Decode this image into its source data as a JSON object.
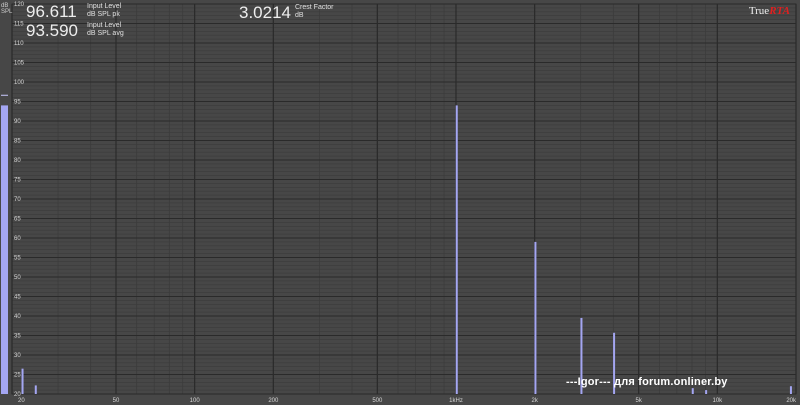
{
  "readouts": {
    "spl_pk_value": "96.611",
    "spl_pk_label1": "Input Level",
    "spl_pk_label2": "dB SPL pk",
    "spl_avg_value": "93.590",
    "spl_avg_label1": "Input Level",
    "spl_avg_label2": "dB SPL avg",
    "crest_value": "3.0214",
    "crest_label1": "Crest Factor",
    "crest_label2": "dB"
  },
  "logo": {
    "true_text": "True",
    "rta_text": "RTA"
  },
  "watermark": "---Igor--- для forum.onliner.by",
  "colors": {
    "background": "#474747",
    "grid_major": "#2a2a2a",
    "grid_minor": "#3b3b3b",
    "bar": "#a4a6f2"
  },
  "chart_data": {
    "type": "bar",
    "title": "",
    "ylabel": "dB SPL",
    "xscale": "log",
    "ylim": [
      20,
      120
    ],
    "xlim": [
      20,
      20000
    ],
    "y_ticks": [
      20,
      25,
      30,
      35,
      40,
      45,
      50,
      55,
      60,
      65,
      70,
      75,
      80,
      85,
      90,
      95,
      100,
      105,
      110,
      115,
      120
    ],
    "x_ticks": [
      {
        "value": 20,
        "label": "20"
      },
      {
        "value": 50,
        "label": "50"
      },
      {
        "value": 100,
        "label": "100"
      },
      {
        "value": 200,
        "label": "200"
      },
      {
        "value": 500,
        "label": "500"
      },
      {
        "value": 1000,
        "label": "1kHz"
      },
      {
        "value": 2000,
        "label": "2k"
      },
      {
        "value": 5000,
        "label": "5k"
      },
      {
        "value": 10000,
        "label": "10k"
      },
      {
        "value": 20000,
        "label": "20k"
      }
    ],
    "bars": [
      {
        "f": 21.8,
        "value": 26.5
      },
      {
        "f": 24.5,
        "value": 22.2
      },
      {
        "f": 1000,
        "value": 94.0
      },
      {
        "f": 2000,
        "value": 59.0
      },
      {
        "f": 3000,
        "value": 39.5
      },
      {
        "f": 4000,
        "value": 35.7
      },
      {
        "f": 8000,
        "value": 21.5
      },
      {
        "f": 9000,
        "value": 21.0
      },
      {
        "f": 19000,
        "value": 22.0
      }
    ],
    "level_meter": {
      "value": 94.0,
      "peak": 96.6
    }
  }
}
